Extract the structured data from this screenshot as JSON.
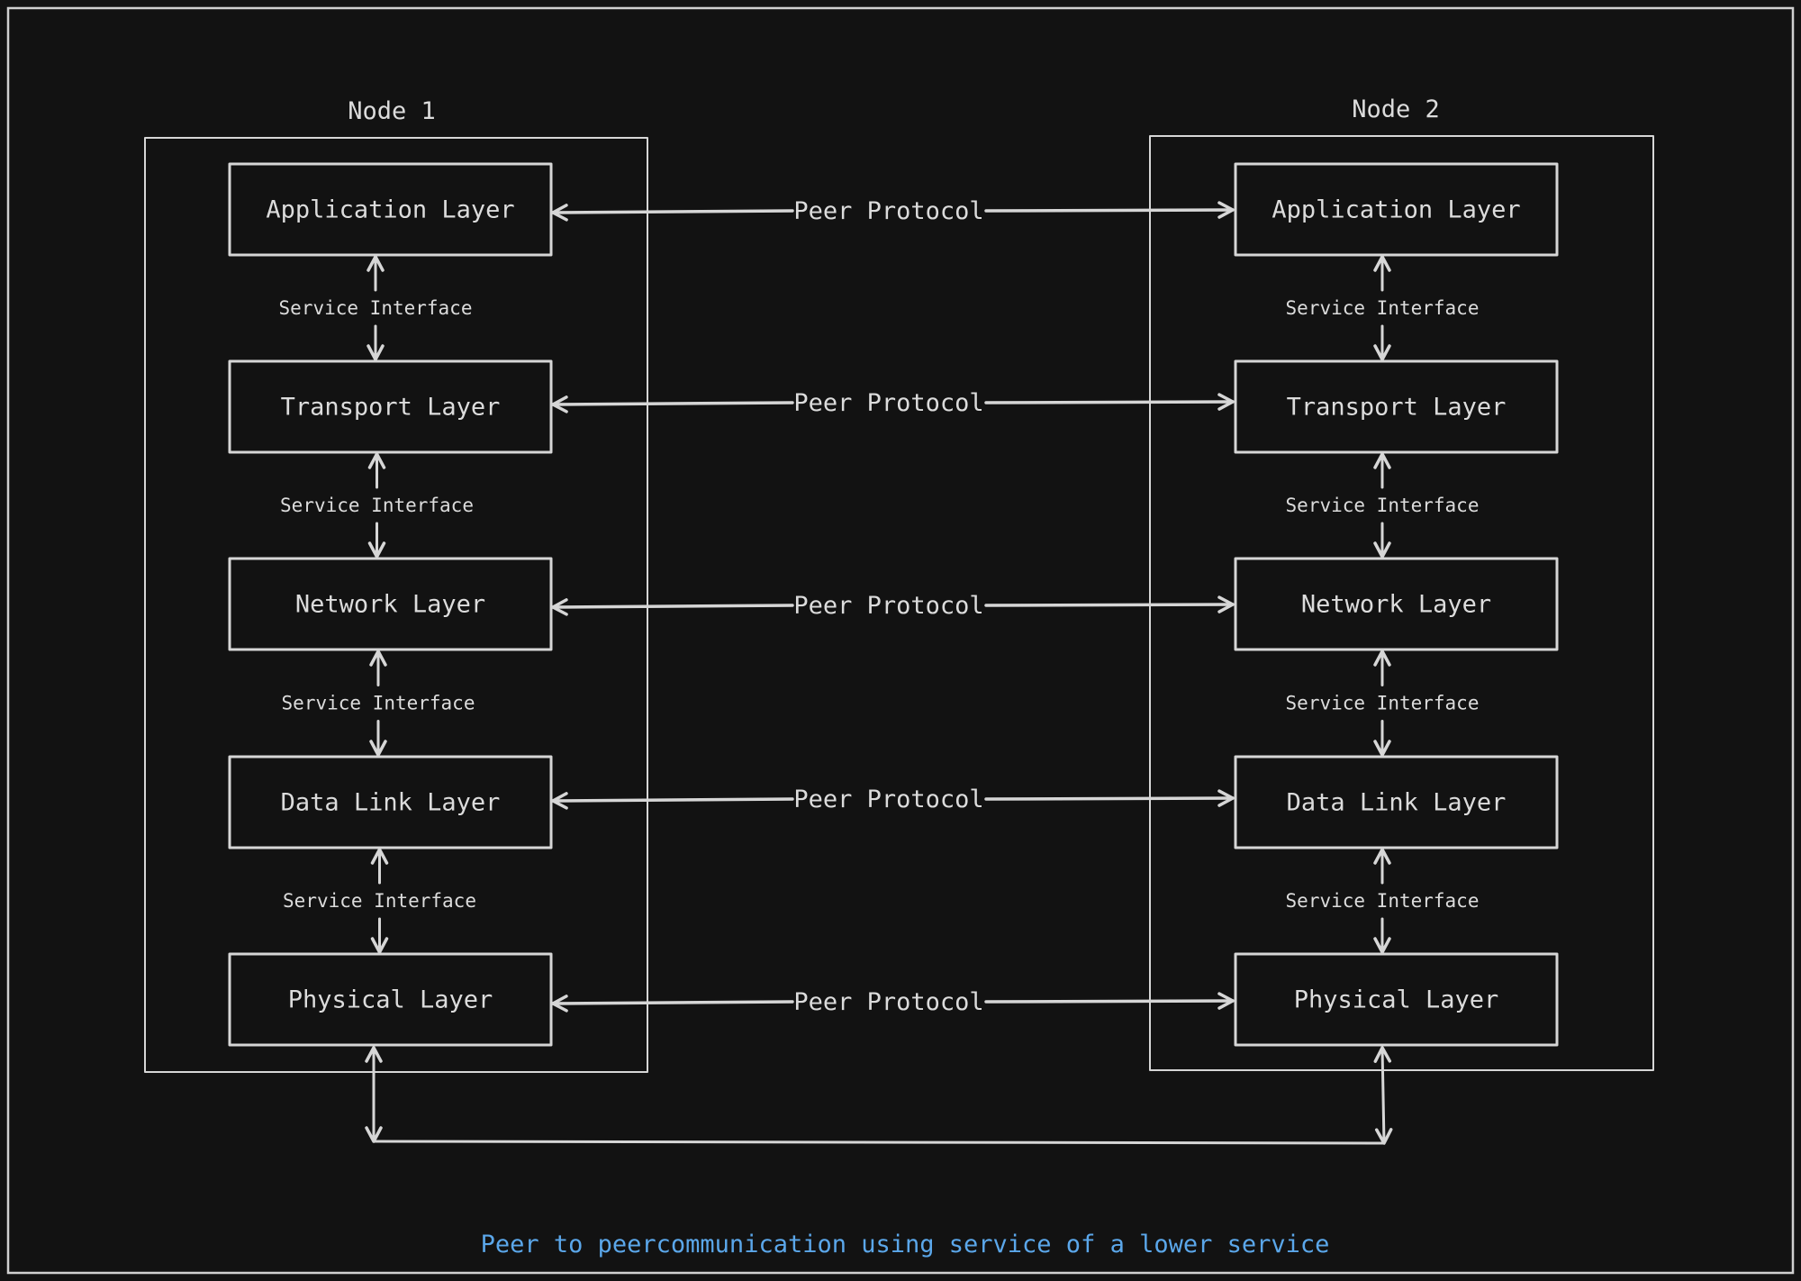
{
  "diagram": {
    "caption": "Peer to peercommunication using service of a lower service",
    "colors": {
      "background": "#121212",
      "stroke": "#d6d6d6",
      "text": "#dcdcdc",
      "caption": "#5ba7ea"
    },
    "nodes": [
      {
        "title": "Node 1",
        "layers": [
          "Application Layer",
          "Transport Layer",
          "Network Layer",
          "Data Link Layer",
          "Physical Layer"
        ],
        "service_interfaces": [
          "Service Interface",
          "Service Interface",
          "Service Interface",
          "Service Interface"
        ]
      },
      {
        "title": "Node 2",
        "layers": [
          "Application Layer",
          "Transport Layer",
          "Network Layer",
          "Data Link Layer",
          "Physical Layer"
        ],
        "service_interfaces": [
          "Service Interface",
          "Service Interface",
          "Service Interface",
          "Service Interface"
        ]
      }
    ],
    "peer_protocols": [
      "Peer Protocol",
      "Peer Protocol",
      "Peer Protocol",
      "Peer Protocol",
      "Peer Protocol"
    ],
    "physical_link": {
      "from": "Node 1 Physical Layer",
      "to": "Node 2 Physical Layer",
      "bidirectional": true
    }
  }
}
